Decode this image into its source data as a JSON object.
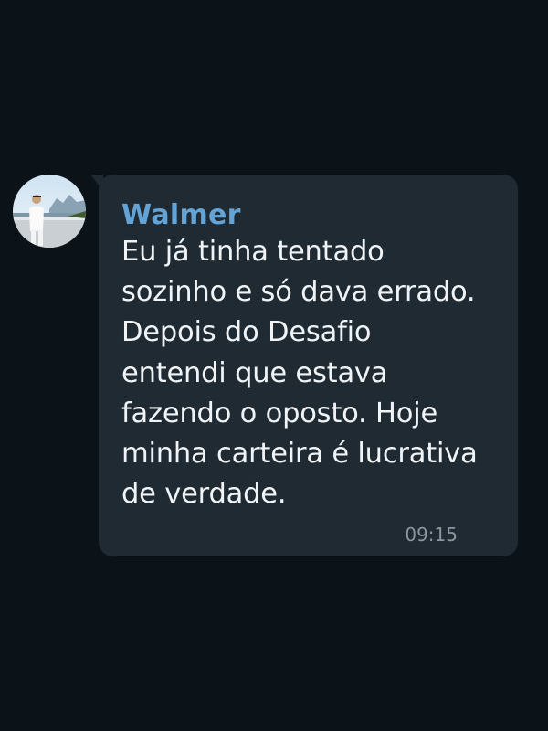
{
  "chat": {
    "message": {
      "sender": "Walmer",
      "text": "Eu já tinha tentado\nsozinho e só dava errado.\nDepois do Desafio\nentendi que estava\nfazendo o oposto. Hoje\nminha carteira é lucrativa\nde verdade.",
      "time": "09:15"
    },
    "avatar_icon": "user-photo-avatar"
  },
  "colors": {
    "background": "#0b1218",
    "bubble": "#1f2a33",
    "sender_name": "#63a3d6",
    "message_text": "#f1f4f6",
    "timestamp": "#8a96a0"
  }
}
